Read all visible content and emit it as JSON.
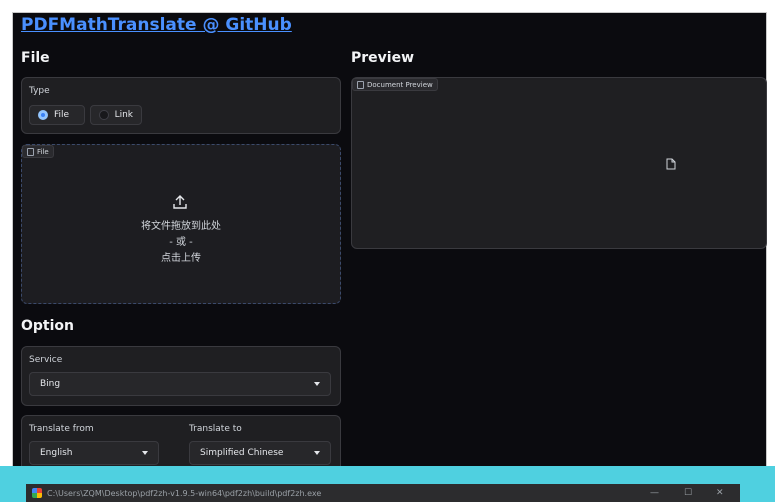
{
  "header": {
    "title": "PDFMathTranslate @ GitHub"
  },
  "file_section": {
    "heading": "File",
    "type_label": "Type",
    "type_options": [
      "File",
      "Link"
    ],
    "selected_type": "File",
    "upload_tag": "File",
    "upload_line1": "将文件拖放到此处",
    "upload_line2": "- 或 -",
    "upload_line3": "点击上传"
  },
  "preview_section": {
    "heading": "Preview",
    "tag": "Document Preview"
  },
  "option_section": {
    "heading": "Option",
    "service_label": "Service",
    "service_value": "Bing",
    "from_label": "Translate from",
    "from_value": "English",
    "to_label": "Translate to",
    "to_value": "Simplified Chinese"
  },
  "console_window": {
    "path": "C:\\Users\\ZQM\\Desktop\\pdf2zh-v1.9.5-win64\\pdf2zh\\build\\pdf2zh.exe",
    "minimize": "—",
    "maximize": "☐",
    "close": "✕"
  },
  "colors": {
    "accent": "#3b82f6",
    "link": "#4a90ff",
    "background": "#0b0b0f",
    "taskbar": "#4fd0e0"
  }
}
